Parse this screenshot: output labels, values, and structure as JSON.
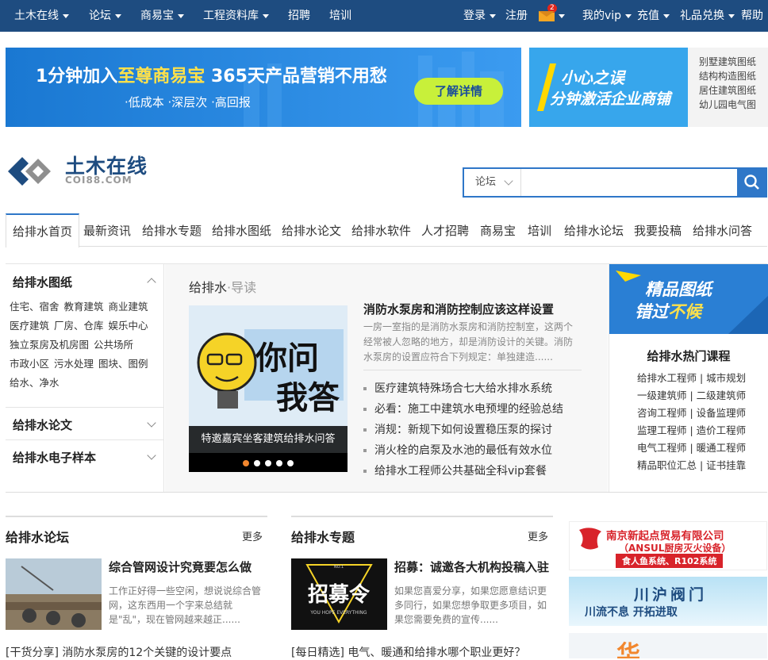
{
  "topnav": {
    "left": [
      "土木在线",
      "论坛",
      "商易宝",
      "工程资料库",
      "招聘",
      "培训"
    ],
    "login": "登录",
    "register": "注册",
    "mail_count": "2",
    "vip": "我的vip",
    "recharge": "充值",
    "gift": "礼品兑换",
    "help": "帮助"
  },
  "banner1": {
    "title_a": "1分钟加入",
    "title_b": "至尊商易宝",
    "title_c": " 365天产品营销不用愁",
    "sub": "·低成本  ·深层次  ·高回报",
    "button": "了解详情"
  },
  "banner2": {
    "line1": "小心之误",
    "line2": "分钟激活企业商铺"
  },
  "side_links": [
    "别墅建筑图纸",
    "结构构造图纸",
    "居住建筑图纸",
    "幼儿园电气图"
  ],
  "logo": {
    "text": "土木在线",
    "sub": "COI88.COM"
  },
  "search": {
    "scope": "论坛",
    "placeholder": ""
  },
  "subnav": [
    "给排水首页",
    "最新资讯",
    "给排水专题",
    "给排水图纸",
    "给排水论文",
    "给排水软件",
    "人才招聘",
    "商易宝",
    "培训",
    "给排水论坛",
    "我要投稿",
    "给排水问答"
  ],
  "left": {
    "drawings_title": "给排水图纸",
    "drawings_links": [
      [
        "住宅、宿舍",
        "教育建筑",
        "商业建筑"
      ],
      [
        "医疗建筑",
        "厂房、仓库",
        "娱乐中心"
      ],
      [
        "独立泵房及机房图",
        "公共场所"
      ],
      [
        "市政小区",
        "污水处理",
        "图块、图例"
      ],
      [
        "给水、净水"
      ]
    ],
    "papers_title": "给排水论文",
    "samples_title": "给排水电子样本"
  },
  "center": {
    "guide_a": "给排水",
    "guide_b": "·导读",
    "slider_caption": "特邀嘉宾坐客建筑给排水问答",
    "slider_text_a": "你问",
    "slider_text_b": "我答",
    "feature_title": "消防水泵房和消防控制应该这样设置",
    "feature_desc": "一房一室指的是消防水泵房和消防控制室，这两个经常被人忽略的地方，却是消防设计的关键。消防水泵房的设置应符合下列规定：单独建造......",
    "news": [
      "医疗建筑特殊场合七大给水排水系统",
      "必看：施工中建筑水电预埋的经验总结",
      "消规：新规下如何设置稳压泵的探讨",
      "消火栓的启泵及水池的最低有效水位",
      "给排水工程师公共基础全科vip套餐"
    ]
  },
  "right": {
    "banner_a": "精品图纸",
    "banner_b1": "错过",
    "banner_b2": "不候",
    "hot_title": "给排水热门课程",
    "hot_links": [
      "给排水工程师 | 城市规划",
      "一级建筑师 | 二级建筑师",
      "咨询工程师 | 设备监理师",
      "监理工程师 | 造价工程师",
      "电气工程师 | 暖通工程师",
      "精品职位汇总 | 证书挂靠"
    ]
  },
  "forum": {
    "title": "给排水论坛",
    "more": "更多",
    "item_title": "综合管网设计究竟要怎么做",
    "item_desc": "工作正好得一些空闲，想说说综合管网，这东西用一个字来总结就是\"乱\"，现在管网越来越正......",
    "list_first": "[干货分享] 消防水泵房的12个关键的设计要点"
  },
  "topic": {
    "title": "给排水专题",
    "more": "更多",
    "item_title": "招募：诚邀各大机构投稿入驻",
    "item_desc": "如果您喜爱分享，如果您愿意结识更多同行，如果您想争取更多项目，如果您需要免费的宣传......",
    "list_first": "[每日精选] 电气、暖通和给排水哪个职业更好？",
    "poster_text": "招募令",
    "poster_sub": "YOU HOPE EVERYTHING",
    "poster_no": "NO.1"
  },
  "ads": {
    "ad1_title": "南京新起点贸易有限公司",
    "ad1_sub": "（ANSUL厨房灭火设备）",
    "ad1_tag": "食人鱼系统、R102系统",
    "ad2_a": "川沪阀门",
    "ad2_b": "川流不息  开拓进取",
    "ad3": "华"
  },
  "colors": {
    "topbar": "#1e4c80",
    "accent": "#2f77c8",
    "orange": "#f2872e"
  }
}
